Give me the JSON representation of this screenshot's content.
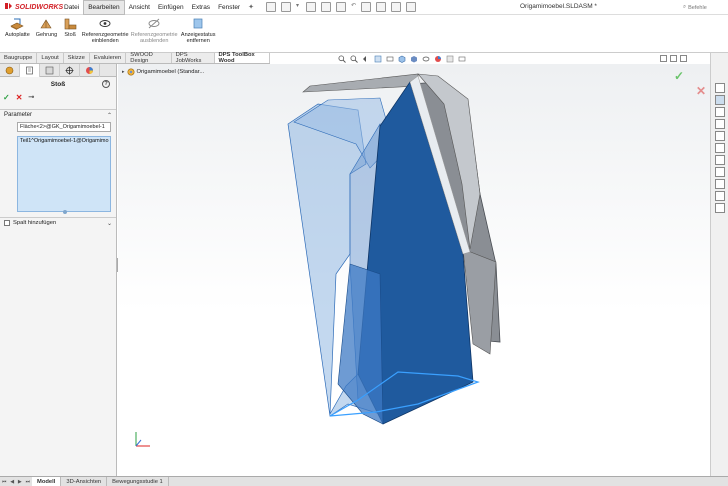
{
  "app": {
    "logo_brand": "SOLIDWORKS",
    "document_title": "Origamimoebel.SLDASM *",
    "search_label": "Befehle"
  },
  "menu": {
    "items": [
      "Datei",
      "Bearbeiten",
      "Ansicht",
      "Einfügen",
      "Extras",
      "Fenster"
    ],
    "active": "Bearbeiten"
  },
  "ribbon": {
    "buttons": [
      {
        "label": "Autoplatte",
        "icon": "plate-icon"
      },
      {
        "label": "Gehrung",
        "icon": "miter-icon"
      },
      {
        "label": "Stoß",
        "icon": "joint-icon"
      },
      {
        "label": "Referenzgeometrie einblenden",
        "icon": "eye-icon"
      },
      {
        "label": "Referenzgeometrie ausblenden",
        "icon": "eye-off-icon"
      },
      {
        "label": "Anzeigestatus entfernen",
        "icon": "display-state-icon"
      }
    ]
  },
  "command_tabs": {
    "items": [
      "Baugruppe",
      "Layout",
      "Skizze",
      "Evaluieren",
      "SWOOD Design",
      "DPS JobWorks",
      "DPS ToolBox Wood"
    ],
    "active": "DPS ToolBox Wood"
  },
  "property_manager": {
    "title": "Stoß",
    "group": "Parameter",
    "face_field": "Fläche<2>@GK_Origamimoebel-1",
    "selection_items": [
      "Teil1^Origamimoebel-1@Origamimo"
    ],
    "gap_label": "Spalt hinzufügen"
  },
  "viewport": {
    "tree_item": "Origamimoebel  (Standar..."
  },
  "bottom_tabs": {
    "items": [
      "Modell",
      "3D-Ansichten",
      "Bewegungsstudie 1"
    ],
    "active": "Modell"
  },
  "colors": {
    "model_blue": "#1f5a9e",
    "model_grey": "#8a8e94",
    "accent_red": "#d21f26"
  }
}
